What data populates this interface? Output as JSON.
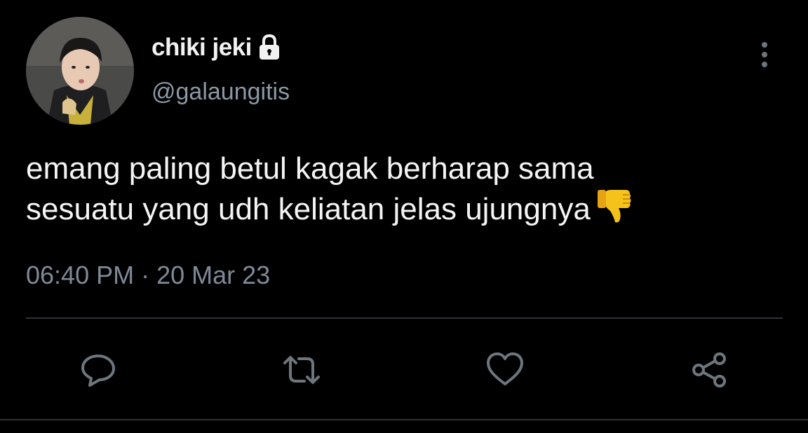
{
  "user": {
    "display_name": "chiki jeki",
    "handle": "@galaungitis",
    "protected_icon": "lock-icon"
  },
  "tweet": {
    "line1": "emang paling betul kagak berharap sama",
    "line2": "sesuatu yang udh keliatan jelas ujungnya",
    "emoji": "thumbs-down-emoji"
  },
  "meta": {
    "timestamp": "06:40 PM · 20 Mar 23"
  },
  "actions": {
    "icons": [
      "comment-icon",
      "retweet-icon",
      "like-icon",
      "share-icon"
    ]
  },
  "colors": {
    "background": "#000000",
    "muted": "#8b98a5",
    "divider": "#2f3336",
    "emoji": "#f5c21b"
  }
}
